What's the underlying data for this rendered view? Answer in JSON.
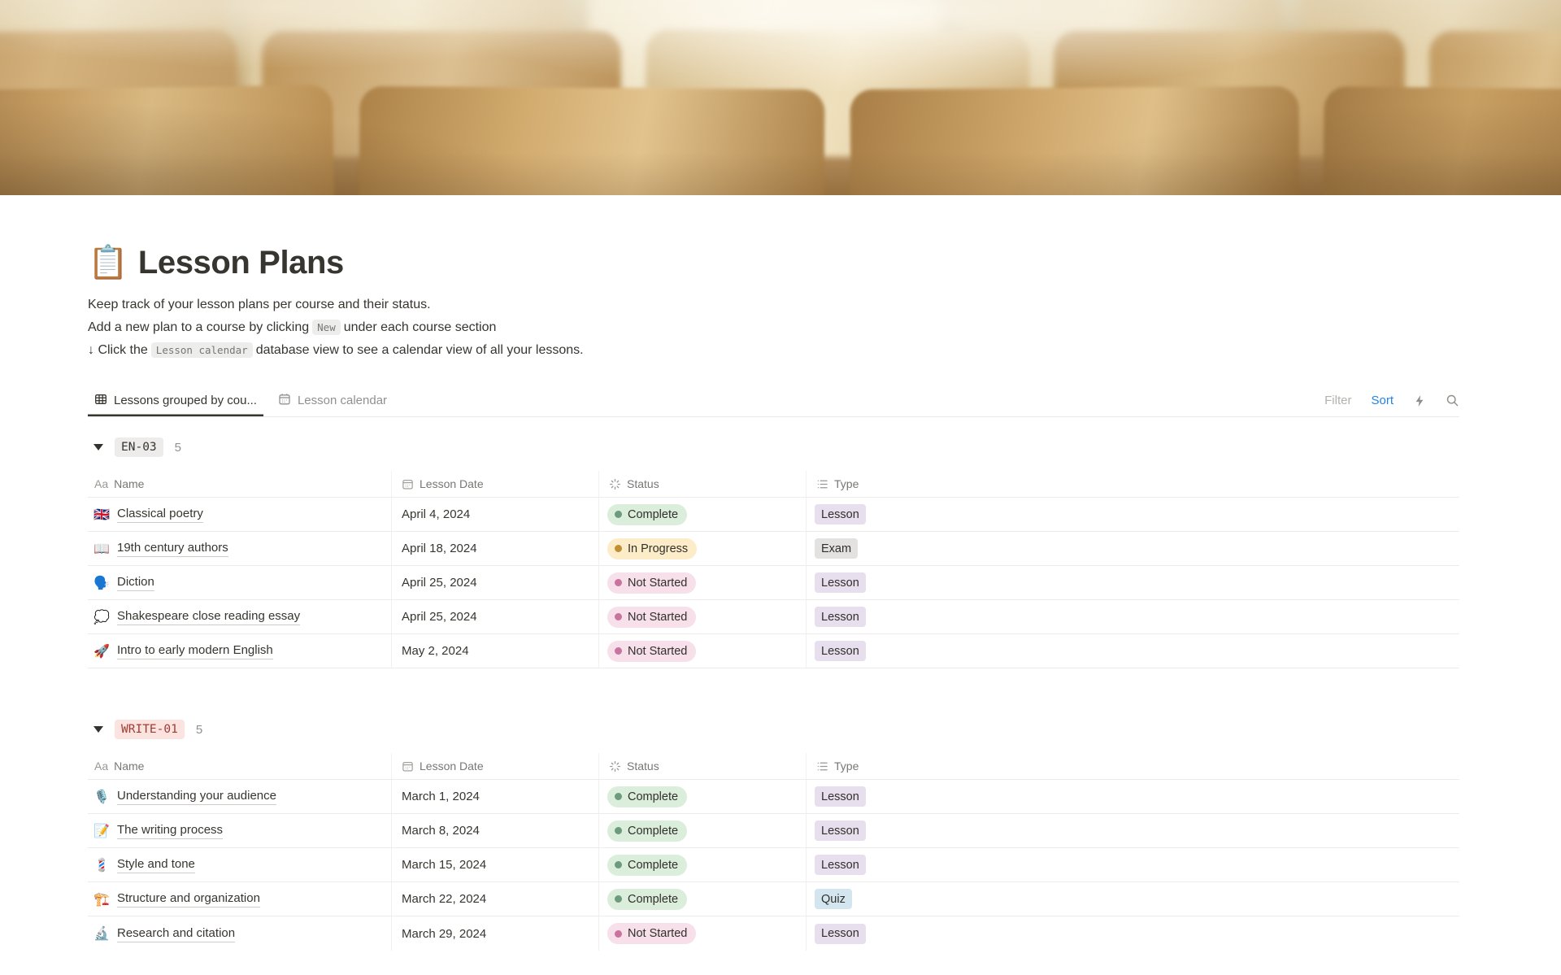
{
  "page": {
    "icon": "📋",
    "title": "Lesson Plans"
  },
  "description": {
    "line1": "Keep track of your lesson plans per course and their status.",
    "line2_pre": "Add a new plan to a course by clicking",
    "line2_code": "New",
    "line2_post": "under each course section",
    "line3_pre": "↓ Click the",
    "line3_code": "Lesson calendar",
    "line3_post": "database view to see a calendar view of all your lessons."
  },
  "tabs": [
    {
      "label": "Lessons grouped by cou...",
      "icon": "table-view-icon",
      "active": true
    },
    {
      "label": "Lesson calendar",
      "icon": "calendar-view-icon",
      "active": false
    }
  ],
  "toolbar": {
    "filter_label": "Filter",
    "sort_label": "Sort",
    "sort_color": "#2383E2",
    "icons": [
      "lightning-icon",
      "search-icon"
    ]
  },
  "columns": {
    "name_icon": "Aa",
    "name": "Name",
    "date": "Lesson Date",
    "status": "Status",
    "type": "Type"
  },
  "groups": [
    {
      "badge": "EN-03",
      "badge_bg": "#EDECEB",
      "badge_text_color": "#37352F",
      "count": "5",
      "rows": [
        {
          "emoji": "🇬🇧",
          "name": "Classical poetry",
          "date": "April 4, 2024",
          "status": "Complete",
          "status_color": "green",
          "type": "Lesson",
          "type_color": "purple"
        },
        {
          "emoji": "📖",
          "name": "19th century authors",
          "date": "April 18, 2024",
          "status": "In Progress",
          "status_color": "yellow",
          "type": "Exam",
          "type_color": "gray"
        },
        {
          "emoji": "🗣️",
          "name": "Diction",
          "date": "April 25, 2024",
          "status": "Not Started",
          "status_color": "pink",
          "type": "Lesson",
          "type_color": "purple"
        },
        {
          "emoji": "💭",
          "name": "Shakespeare close reading essay",
          "date": "April 25, 2024",
          "status": "Not Started",
          "status_color": "pink",
          "type": "Lesson",
          "type_color": "purple"
        },
        {
          "emoji": "🚀",
          "name": "Intro to early modern English",
          "date": "May 2, 2024",
          "status": "Not Started",
          "status_color": "pink",
          "type": "Lesson",
          "type_color": "purple"
        }
      ]
    },
    {
      "badge": "WRITE-01",
      "badge_bg": "#FBE3DF",
      "badge_text_color": "#9E3B33",
      "count": "5",
      "rows": [
        {
          "emoji": "🎙️",
          "name": "Understanding your audience",
          "date": "March 1, 2024",
          "status": "Complete",
          "status_color": "green",
          "type": "Lesson",
          "type_color": "purple"
        },
        {
          "emoji": "📝",
          "name": "The writing process",
          "date": "March 8, 2024",
          "status": "Complete",
          "status_color": "green",
          "type": "Lesson",
          "type_color": "purple"
        },
        {
          "emoji": "💈",
          "name": "Style and tone",
          "date": "March 15, 2024",
          "status": "Complete",
          "status_color": "green",
          "type": "Lesson",
          "type_color": "purple"
        },
        {
          "emoji": "🏗️",
          "name": "Structure and organization",
          "date": "March 22, 2024",
          "status": "Complete",
          "status_color": "green",
          "type": "Quiz",
          "type_color": "blue"
        },
        {
          "emoji": "🔬",
          "name": "Research and citation",
          "date": "March 29, 2024",
          "status": "Not Started",
          "status_color": "pink",
          "type": "Lesson",
          "type_color": "purple"
        }
      ]
    }
  ],
  "colors": {
    "status_complete_bg": "#DBEDDB",
    "status_complete_dot": "#6C9B7D",
    "status_inprogress_bg": "#FDECC8",
    "status_inprogress_dot": "#C18E34",
    "status_notstarted_bg": "#F7E0E9",
    "status_notstarted_dot": "#C9749E",
    "type_lesson_bg": "#E7DEEE",
    "type_exam_bg": "#E3E2E0",
    "type_quiz_bg": "#D3E5EF",
    "accent_blue": "#2383E2",
    "text_primary": "#37352F",
    "text_secondary": "#787774"
  }
}
